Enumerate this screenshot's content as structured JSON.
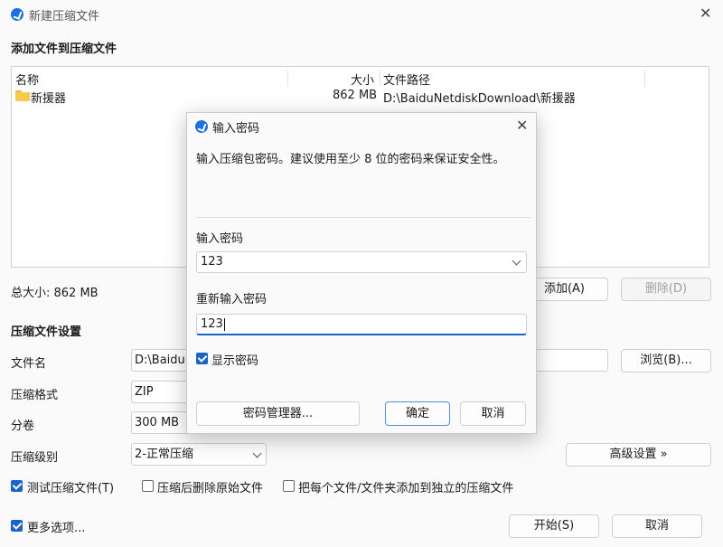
{
  "main": {
    "title": "新建压缩文件",
    "add_section": "添加文件到压缩文件",
    "columns": [
      "名称",
      "大小",
      "文件路径"
    ],
    "rows": [
      {
        "name": "新援器",
        "size": "862 MB",
        "path": "D:\\BaiduNetdiskDownload\\新援器"
      }
    ],
    "total_size": "总大小: 862 MB",
    "add_button": "添加(A)",
    "remove_button": "删除(D)",
    "settings_section": "压缩文件设置",
    "filename_label": "文件名",
    "filename_value": "D:\\Baidu",
    "browse_button": "浏览(B)...",
    "format_label": "压缩格式",
    "format_value": "ZIP",
    "split_label": "分卷",
    "split_value": "300 MB",
    "level_label": "压缩级别",
    "level_value": "2-正常压缩",
    "advanced_button": "高级设置 »",
    "test_checkbox": "测试压缩文件(T)",
    "delete_checkbox": "压缩后删除原始文件",
    "separate_checkbox": "把每个文件/文件夹添加到独立的压缩文件",
    "more_options": "更多选项...",
    "start_button": "开始(S)",
    "cancel_button": "取消"
  },
  "dialog": {
    "title": "输入密码",
    "description": "输入压缩包密码。建议使用至少 8 位的密码来保证安全性。",
    "password_label": "输入密码",
    "password_value": "123",
    "confirm_label": "重新输入密码",
    "confirm_value": "123",
    "show_password": "显示密码",
    "manager_button": "密码管理器...",
    "ok_button": "确定",
    "cancel_button": "取消"
  },
  "colors": {
    "accent": "#1a63c9",
    "folder": "#f6c94f"
  },
  "icons": {
    "app": "zip-app-icon",
    "close": "close-icon",
    "folder": "folder-icon"
  }
}
